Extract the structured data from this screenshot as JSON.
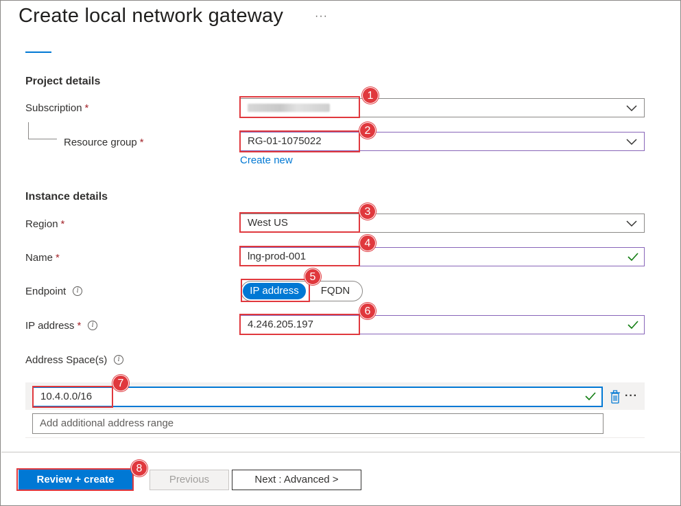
{
  "header": {
    "title": "Create local network gateway",
    "more_label": "···"
  },
  "project": {
    "heading": "Project details",
    "subscription_label": "Subscription",
    "resource_group_label": "Resource group",
    "resource_group_value": "RG-01-1075022",
    "create_new_label": "Create new"
  },
  "instance": {
    "heading": "Instance details",
    "region_label": "Region",
    "region_value": "West US",
    "name_label": "Name",
    "name_value": "lng-prod-001",
    "endpoint_label": "Endpoint",
    "endpoint_options": [
      "IP address",
      "FQDN"
    ],
    "endpoint_selected": "IP address",
    "ip_label": "IP address",
    "ip_value": "4.246.205.197",
    "address_space_label": "Address Space(s)",
    "address_space_value": "10.4.0.0/16",
    "address_space_placeholder": "Add additional address range"
  },
  "required_mark": "*",
  "info_glyph": "i",
  "footer": {
    "review_create_label": "Review + create",
    "previous_label": "Previous",
    "next_label": "Next : Advanced >"
  },
  "callouts": [
    "1",
    "2",
    "3",
    "4",
    "5",
    "6",
    "7",
    "8"
  ],
  "colors": {
    "accent": "#0078d4",
    "callout_red": "#e0383d",
    "valid_green": "#107c10",
    "required_red": "#a4262c",
    "focus_purple": "#8764b8"
  },
  "icons": {
    "dropdown": "chevron-down-icon",
    "valid": "checkmark-icon",
    "info": "info-icon",
    "delete": "trash-icon",
    "more": "more-icon"
  }
}
